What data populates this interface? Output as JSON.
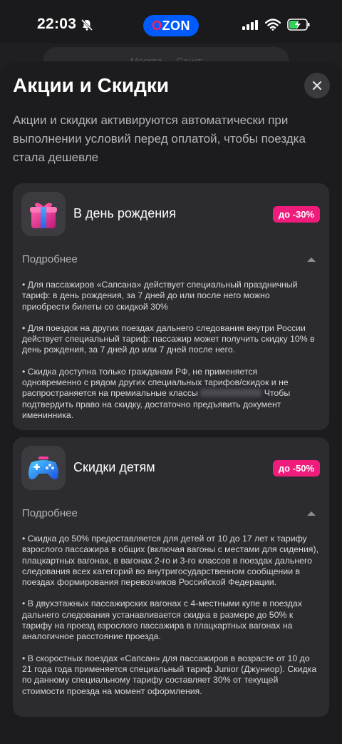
{
  "status_bar": {
    "time": "22:03",
    "brand": "OZON",
    "icons": [
      "bell-off-icon",
      "cellular-signal-icon",
      "wifi-icon",
      "battery-charging-icon"
    ]
  },
  "background_page": {
    "search_text": "Москва — Санкт"
  },
  "sheet": {
    "title": "Акции и Скидки",
    "description": "Акции и скидки активируются автоматически при выполнении условий перед оплатой, чтобы поездка стала дешевле",
    "close_icon": "close-icon"
  },
  "cards": [
    {
      "icon": "gift-icon",
      "title": "В день рождения",
      "badge": "до -30%",
      "more_label": "Подробнее",
      "paragraphs": [
        "• Для пассажиров «Сапсана» действует специальный праздничный тариф: в день рождения, за 7 дней до или после него можно приобрести билеты со скидкой 30%",
        "• Для поездок на других поездах дальнего следования внутри России действует специальный тариф: пассажир может получить скидку 10% в день рождения, за 7 дней до или 7 дней после него.",
        " • Скидка доступна только гражданам РФ, не применяется одновременно с рядом других специальных тарифов/скидок и не распространяется на премиальные классы"
      ],
      "paragraph_tail": " Чтобы подтвердить право на скидку, достаточно предъявить документ именинника."
    },
    {
      "icon": "gamepad-icon",
      "title": "Скидки детям",
      "badge": "до -50%",
      "more_label": "Подробнее",
      "paragraphs": [
        "• Скидка до 50% предоставляется для детей от 10 до 17 лет к тарифу взрослого пассажира в общих (включая вагоны с местами для сидения), плацкартных вагонах, в вагонах 2-го и 3-го классов в поездах дальнего следования всех категорий во внутригосударственном сообщении в поездах формирования перевозчиков Российской Федерации.",
        "• В двухэтажных пассажирских вагонах с 4-местными купе в поездах дальнего следования устанавливается скидка в размере до 50% к тарифу на проезд взрослого пассажира в плацкартных вагонах на аналогичное расстояние проезда.",
        " • В скоростных поездах «Сапсан» для пассажиров в возрасте от 10 до 21 года года применяется специальный тариф Junior (Джуниор). Скидка по данному специальному тарифу составляет 30% от текущей стоимости проезда на момент оформления."
      ]
    }
  ],
  "colors": {
    "badge": "#f01c7c",
    "sheet_bg": "#1c1c1e",
    "card_bg": "#2c2c30",
    "brand_blue": "#005bff"
  }
}
